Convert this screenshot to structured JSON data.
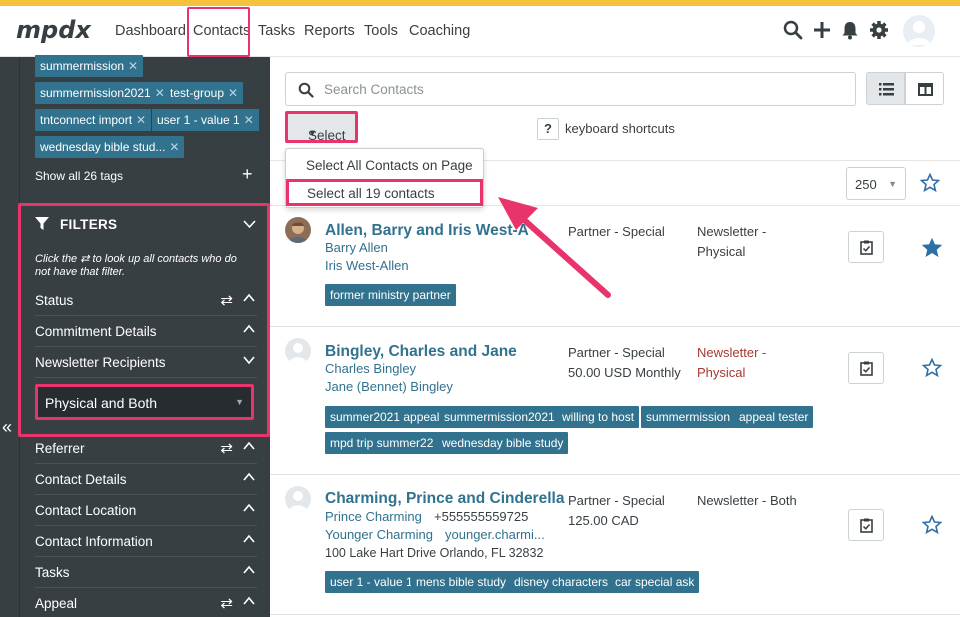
{
  "nav": {
    "logo_text": "mpdx",
    "items": [
      "Dashboard",
      "Contacts",
      "Tasks",
      "Reports",
      "Tools",
      "Coaching"
    ]
  },
  "sidebar": {
    "tags": [
      {
        "label": "summermission"
      },
      {
        "label": "summermission2021"
      },
      {
        "label": "test-group"
      },
      {
        "label": "tntconnect import"
      },
      {
        "label": "user 1 - value 1"
      },
      {
        "label": "wednesday bible stud..."
      }
    ],
    "show_all_tags": "Show all 26 tags",
    "filters_title": "FILTERS",
    "filter_note_pre": "Click the",
    "filter_note_post": " to look up all contacts who do not have that filter.",
    "filters": [
      "Status",
      "Commitment Details",
      "Newsletter Recipients",
      "Referrer",
      "Contact Details",
      "Contact Location",
      "Contact Information",
      "Tasks",
      "Appeal"
    ],
    "newsletter_selected": "Physical and Both"
  },
  "toolbar": {
    "search_placeholder": "Search Contacts",
    "select_label": "Select",
    "keyboard_q": "?",
    "keyboard_label": "keyboard shortcuts",
    "per_page": "250"
  },
  "dropdown": {
    "item1": "Select All Contacts on Page",
    "item2": "Select all 19 contacts"
  },
  "contacts": [
    {
      "name": "Allen, Barry and Iris West-A",
      "people": [
        "Barry Allen",
        "Iris West-Allen"
      ],
      "status": "Partner - Special",
      "pledge": "",
      "newsletter": "Newsletter - Physical",
      "tags": [
        "former ministry partner"
      ],
      "starred": true
    },
    {
      "name": "Bingley, Charles and Jane",
      "people": [
        "Charles Bingley",
        "Jane (Bennet) Bingley"
      ],
      "status": "Partner - Special",
      "pledge": "50.00 USD Monthly",
      "newsletter": "Newsletter - Physical",
      "tags": [
        "summer2021 appeal",
        "summermission2021",
        "willing to host",
        "summermission",
        "appeal tester",
        "mpd trip summer22",
        "wednesday bible study"
      ],
      "starred": false
    },
    {
      "name": "Charming, Prince and Cinderella",
      "people": [
        "Prince Charming",
        "Younger Charming"
      ],
      "phone": "+555555559725",
      "email": "younger.charmi...",
      "address": "100 Lake Hart Drive Orlando, FL 32832",
      "status": "Partner - Special",
      "pledge": "125.00 CAD",
      "newsletter": "Newsletter - Both",
      "tags": [
        "user 1 - value 1",
        "mens bible study",
        "disney characters",
        "car special ask"
      ],
      "starred": false
    }
  ],
  "colors": {
    "accent_bar": "#F5C33B",
    "highlight": "#E8336B",
    "link": "#31728E",
    "sidebar": "#383F43",
    "newsletter_red": "#A43A32",
    "star": "#2F6FA8"
  }
}
